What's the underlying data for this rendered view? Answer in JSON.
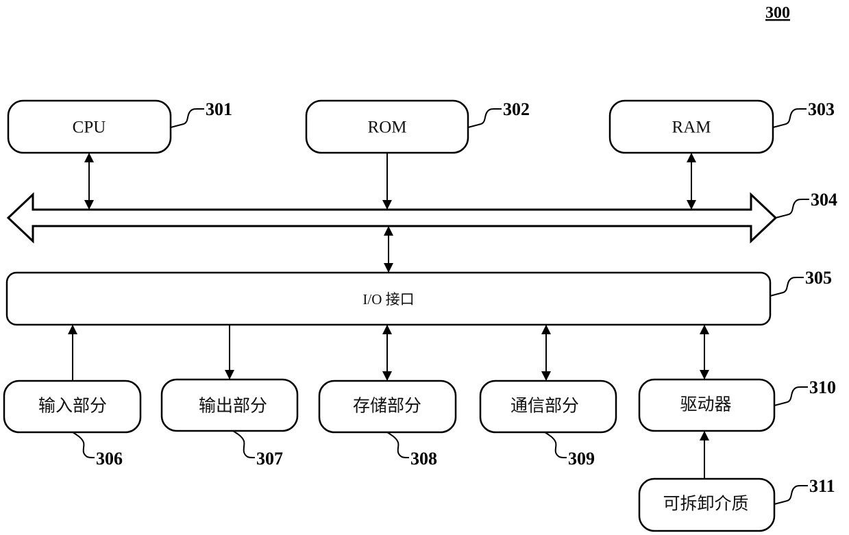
{
  "figure": {
    "figure_number": "300",
    "colors": {
      "stroke": "#000000",
      "background": "#ffffff",
      "text": "#111111"
    }
  },
  "blocks": {
    "cpu": {
      "label": "CPU",
      "ref": "301"
    },
    "rom": {
      "label": "ROM",
      "ref": "302"
    },
    "ram": {
      "label": "RAM",
      "ref": "303"
    },
    "bus": {
      "label": "",
      "ref": "304"
    },
    "io": {
      "label": "I/O 接口",
      "ref": "305"
    },
    "input": {
      "label": "输入部分",
      "ref": "306"
    },
    "output": {
      "label": "输出部分",
      "ref": "307"
    },
    "storage": {
      "label": "存储部分",
      "ref": "308"
    },
    "comm": {
      "label": "通信部分",
      "ref": "309"
    },
    "driver": {
      "label": "驱动器",
      "ref": "310"
    },
    "media": {
      "label": "可拆卸介质",
      "ref": "311"
    }
  },
  "connections": [
    {
      "from": "cpu",
      "to": "bus",
      "direction": "bidirectional"
    },
    {
      "from": "rom",
      "to": "bus",
      "direction": "to-bus"
    },
    {
      "from": "ram",
      "to": "bus",
      "direction": "bidirectional"
    },
    {
      "from": "bus",
      "to": "io",
      "direction": "bidirectional"
    },
    {
      "from": "input",
      "to": "io",
      "direction": "up"
    },
    {
      "from": "io",
      "to": "output",
      "direction": "down"
    },
    {
      "from": "io",
      "to": "storage",
      "direction": "bidirectional"
    },
    {
      "from": "io",
      "to": "comm",
      "direction": "bidirectional"
    },
    {
      "from": "io",
      "to": "driver",
      "direction": "bidirectional"
    },
    {
      "from": "media",
      "to": "driver",
      "direction": "up"
    }
  ]
}
